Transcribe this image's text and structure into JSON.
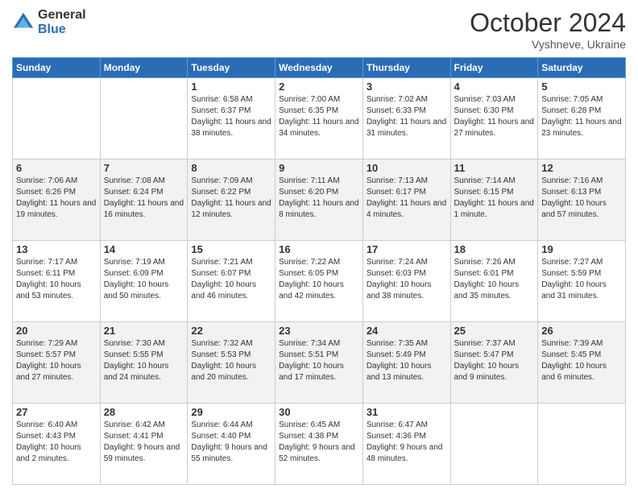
{
  "logo": {
    "general": "General",
    "blue": "Blue"
  },
  "header": {
    "month": "October 2024",
    "location": "Vyshneve, Ukraine"
  },
  "days_of_week": [
    "Sunday",
    "Monday",
    "Tuesday",
    "Wednesday",
    "Thursday",
    "Friday",
    "Saturday"
  ],
  "weeks": [
    [
      {
        "day": "",
        "empty": true
      },
      {
        "day": "",
        "empty": true
      },
      {
        "day": "1",
        "sunrise": "Sunrise: 6:58 AM",
        "sunset": "Sunset: 6:37 PM",
        "daylight": "Daylight: 11 hours and 38 minutes."
      },
      {
        "day": "2",
        "sunrise": "Sunrise: 7:00 AM",
        "sunset": "Sunset: 6:35 PM",
        "daylight": "Daylight: 11 hours and 34 minutes."
      },
      {
        "day": "3",
        "sunrise": "Sunrise: 7:02 AM",
        "sunset": "Sunset: 6:33 PM",
        "daylight": "Daylight: 11 hours and 31 minutes."
      },
      {
        "day": "4",
        "sunrise": "Sunrise: 7:03 AM",
        "sunset": "Sunset: 6:30 PM",
        "daylight": "Daylight: 11 hours and 27 minutes."
      },
      {
        "day": "5",
        "sunrise": "Sunrise: 7:05 AM",
        "sunset": "Sunset: 6:28 PM",
        "daylight": "Daylight: 11 hours and 23 minutes."
      }
    ],
    [
      {
        "day": "6",
        "sunrise": "Sunrise: 7:06 AM",
        "sunset": "Sunset: 6:26 PM",
        "daylight": "Daylight: 11 hours and 19 minutes."
      },
      {
        "day": "7",
        "sunrise": "Sunrise: 7:08 AM",
        "sunset": "Sunset: 6:24 PM",
        "daylight": "Daylight: 11 hours and 16 minutes."
      },
      {
        "day": "8",
        "sunrise": "Sunrise: 7:09 AM",
        "sunset": "Sunset: 6:22 PM",
        "daylight": "Daylight: 11 hours and 12 minutes."
      },
      {
        "day": "9",
        "sunrise": "Sunrise: 7:11 AM",
        "sunset": "Sunset: 6:20 PM",
        "daylight": "Daylight: 11 hours and 8 minutes."
      },
      {
        "day": "10",
        "sunrise": "Sunrise: 7:13 AM",
        "sunset": "Sunset: 6:17 PM",
        "daylight": "Daylight: 11 hours and 4 minutes."
      },
      {
        "day": "11",
        "sunrise": "Sunrise: 7:14 AM",
        "sunset": "Sunset: 6:15 PM",
        "daylight": "Daylight: 11 hours and 1 minute."
      },
      {
        "day": "12",
        "sunrise": "Sunrise: 7:16 AM",
        "sunset": "Sunset: 6:13 PM",
        "daylight": "Daylight: 10 hours and 57 minutes."
      }
    ],
    [
      {
        "day": "13",
        "sunrise": "Sunrise: 7:17 AM",
        "sunset": "Sunset: 6:11 PM",
        "daylight": "Daylight: 10 hours and 53 minutes."
      },
      {
        "day": "14",
        "sunrise": "Sunrise: 7:19 AM",
        "sunset": "Sunset: 6:09 PM",
        "daylight": "Daylight: 10 hours and 50 minutes."
      },
      {
        "day": "15",
        "sunrise": "Sunrise: 7:21 AM",
        "sunset": "Sunset: 6:07 PM",
        "daylight": "Daylight: 10 hours and 46 minutes."
      },
      {
        "day": "16",
        "sunrise": "Sunrise: 7:22 AM",
        "sunset": "Sunset: 6:05 PM",
        "daylight": "Daylight: 10 hours and 42 minutes."
      },
      {
        "day": "17",
        "sunrise": "Sunrise: 7:24 AM",
        "sunset": "Sunset: 6:03 PM",
        "daylight": "Daylight: 10 hours and 38 minutes."
      },
      {
        "day": "18",
        "sunrise": "Sunrise: 7:26 AM",
        "sunset": "Sunset: 6:01 PM",
        "daylight": "Daylight: 10 hours and 35 minutes."
      },
      {
        "day": "19",
        "sunrise": "Sunrise: 7:27 AM",
        "sunset": "Sunset: 5:59 PM",
        "daylight": "Daylight: 10 hours and 31 minutes."
      }
    ],
    [
      {
        "day": "20",
        "sunrise": "Sunrise: 7:29 AM",
        "sunset": "Sunset: 5:57 PM",
        "daylight": "Daylight: 10 hours and 27 minutes."
      },
      {
        "day": "21",
        "sunrise": "Sunrise: 7:30 AM",
        "sunset": "Sunset: 5:55 PM",
        "daylight": "Daylight: 10 hours and 24 minutes."
      },
      {
        "day": "22",
        "sunrise": "Sunrise: 7:32 AM",
        "sunset": "Sunset: 5:53 PM",
        "daylight": "Daylight: 10 hours and 20 minutes."
      },
      {
        "day": "23",
        "sunrise": "Sunrise: 7:34 AM",
        "sunset": "Sunset: 5:51 PM",
        "daylight": "Daylight: 10 hours and 17 minutes."
      },
      {
        "day": "24",
        "sunrise": "Sunrise: 7:35 AM",
        "sunset": "Sunset: 5:49 PM",
        "daylight": "Daylight: 10 hours and 13 minutes."
      },
      {
        "day": "25",
        "sunrise": "Sunrise: 7:37 AM",
        "sunset": "Sunset: 5:47 PM",
        "daylight": "Daylight: 10 hours and 9 minutes."
      },
      {
        "day": "26",
        "sunrise": "Sunrise: 7:39 AM",
        "sunset": "Sunset: 5:45 PM",
        "daylight": "Daylight: 10 hours and 6 minutes."
      }
    ],
    [
      {
        "day": "27",
        "sunrise": "Sunrise: 6:40 AM",
        "sunset": "Sunset: 4:43 PM",
        "daylight": "Daylight: 10 hours and 2 minutes."
      },
      {
        "day": "28",
        "sunrise": "Sunrise: 6:42 AM",
        "sunset": "Sunset: 4:41 PM",
        "daylight": "Daylight: 9 hours and 59 minutes."
      },
      {
        "day": "29",
        "sunrise": "Sunrise: 6:44 AM",
        "sunset": "Sunset: 4:40 PM",
        "daylight": "Daylight: 9 hours and 55 minutes."
      },
      {
        "day": "30",
        "sunrise": "Sunrise: 6:45 AM",
        "sunset": "Sunset: 4:38 PM",
        "daylight": "Daylight: 9 hours and 52 minutes."
      },
      {
        "day": "31",
        "sunrise": "Sunrise: 6:47 AM",
        "sunset": "Sunset: 4:36 PM",
        "daylight": "Daylight: 9 hours and 48 minutes."
      },
      {
        "day": "",
        "empty": true
      },
      {
        "day": "",
        "empty": true
      }
    ]
  ]
}
